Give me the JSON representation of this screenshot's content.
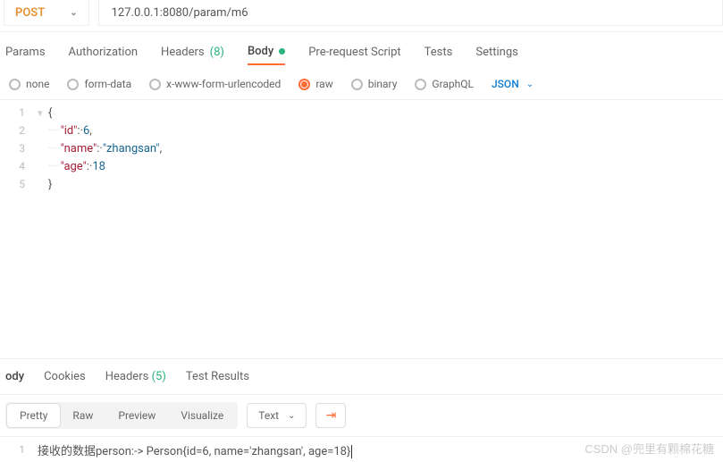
{
  "request": {
    "method": "POST",
    "url": "127.0.0.1:8080/param/m6"
  },
  "tabs": {
    "params": "Params",
    "authorization": "Authorization",
    "headers": "Headers",
    "headers_count": "(8)",
    "body": "Body",
    "prerequest": "Pre-request Script",
    "tests": "Tests",
    "settings": "Settings"
  },
  "body_types": {
    "none": "none",
    "formdata": "form-data",
    "xwww": "x-www-form-urlencoded",
    "raw": "raw",
    "binary": "binary",
    "graphql": "GraphQL",
    "json": "JSON"
  },
  "editor": {
    "lines": {
      "l1": "{",
      "l2_indent": "····",
      "l2_key": "\"id\"",
      "l2_colon": ":·",
      "l2_val": "6",
      "l2_comma": ",",
      "l3_key": "\"name\"",
      "l3_colon": ":·",
      "l3_val": "\"zhangsan\"",
      "l3_comma": ",",
      "l4_key": "\"age\"",
      "l4_colon": ":·",
      "l4_val": "18",
      "l5": "}"
    },
    "nums": {
      "n1": "1",
      "n2": "2",
      "n3": "3",
      "n4": "4",
      "n5": "5"
    }
  },
  "lower_tabs": {
    "body": "ody",
    "cookies": "Cookies",
    "headers": "Headers",
    "headers_count": "(5)",
    "test_results": "Test Results"
  },
  "view_modes": {
    "pretty": "Pretty",
    "raw": "Raw",
    "preview": "Preview",
    "visualize": "Visualize",
    "type": "Text"
  },
  "response": {
    "line1_num": "1",
    "line1_text": "接收的数据person:-> Person{id=6, name='zhangsan', age=18}"
  },
  "watermark": "CSDN @兜里有颗棉花糖"
}
